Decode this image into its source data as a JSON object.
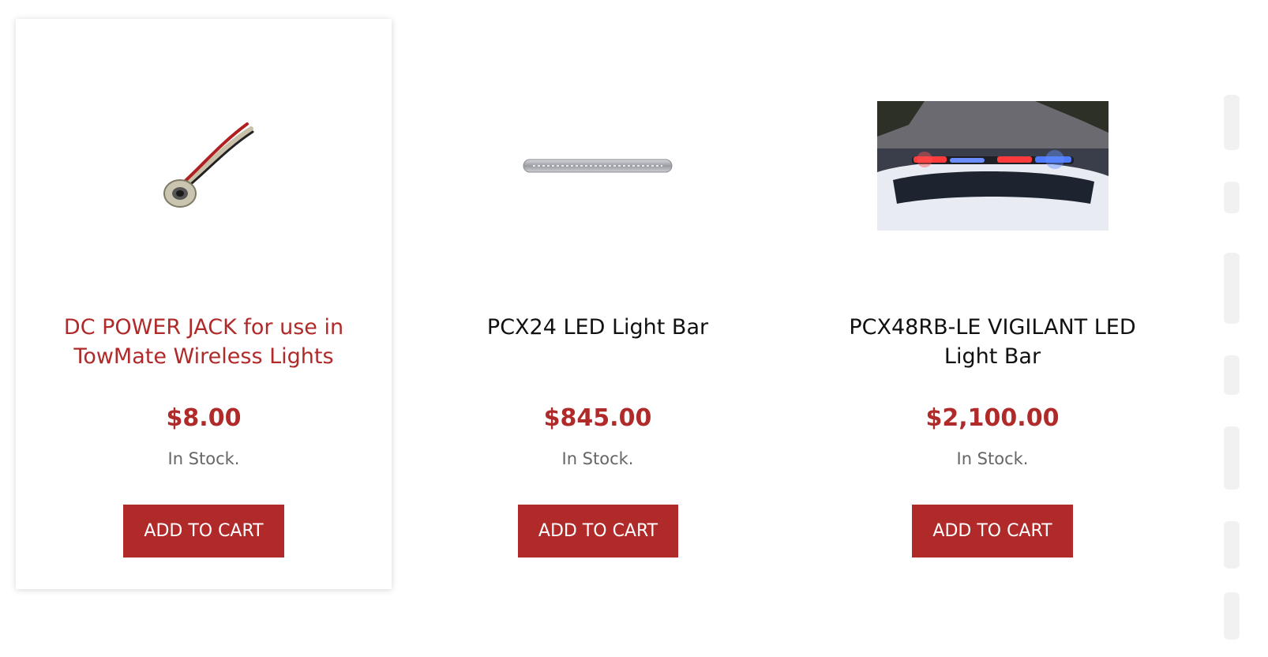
{
  "products": [
    {
      "title": "DC POWER JACK for use in TowMate Wireless Lights",
      "price": "$8.00",
      "stock": "In Stock.",
      "button": "ADD TO CART",
      "image_icon": "dc-power-jack-icon"
    },
    {
      "title": "PCX24 LED Light Bar",
      "price": "$845.00",
      "stock": "In Stock.",
      "button": "ADD TO CART",
      "image_icon": "led-light-bar-icon"
    },
    {
      "title": "PCX48RB-LE VIGILANT LED Light Bar",
      "price": "$2,100.00",
      "stock": "In Stock.",
      "button": "ADD TO CART",
      "image_icon": "vehicle-light-bar-photo"
    }
  ],
  "colors": {
    "accent": "#b02a2a",
    "title_default": "#111111",
    "stock_text": "#666666"
  }
}
